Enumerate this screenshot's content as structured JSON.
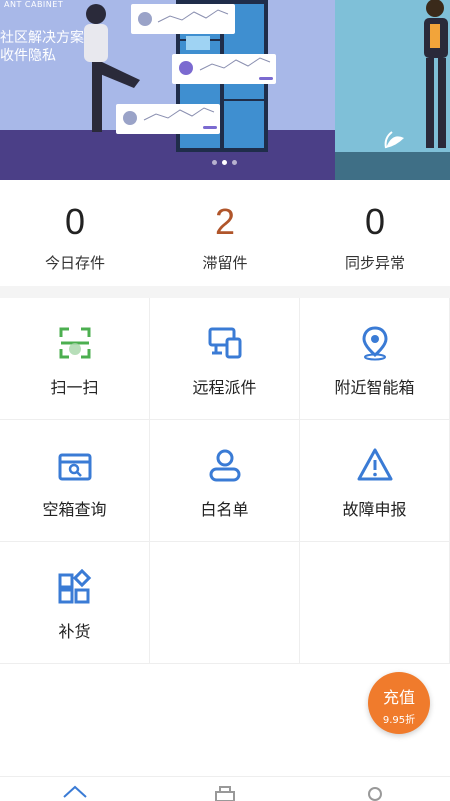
{
  "banner": {
    "brand": "ANT CABINET",
    "headline_line1": "社区解决方案",
    "headline_line2": "收件隐私",
    "dots_active": 2,
    "dots_total": 3
  },
  "stats": [
    {
      "value": "0",
      "label": "今日存件"
    },
    {
      "value": "2",
      "label": "滞留件"
    },
    {
      "value": "0",
      "label": "同步异常"
    }
  ],
  "features": [
    {
      "label": "扫一扫",
      "icon": "scan-icon"
    },
    {
      "label": "远程派件",
      "icon": "remote-dispatch-icon"
    },
    {
      "label": "附近智能箱",
      "icon": "location-pin-icon"
    },
    {
      "label": "空箱查询",
      "icon": "box-search-icon"
    },
    {
      "label": "白名单",
      "icon": "user-icon"
    },
    {
      "label": "故障申报",
      "icon": "warning-icon"
    },
    {
      "label": "补货",
      "icon": "restock-grid-icon"
    }
  ],
  "recharge": {
    "title": "充值",
    "discount": "9.95折"
  },
  "colors": {
    "accent_blue": "#3a7bd5",
    "accent_green": "#4caf50",
    "alert_brown": "#b0552a",
    "recharge_orange": "#f07b2c"
  },
  "tabbar": [
    {
      "icon": "home-icon"
    },
    {
      "icon": "briefcase-icon"
    },
    {
      "icon": "profile-icon"
    }
  ]
}
